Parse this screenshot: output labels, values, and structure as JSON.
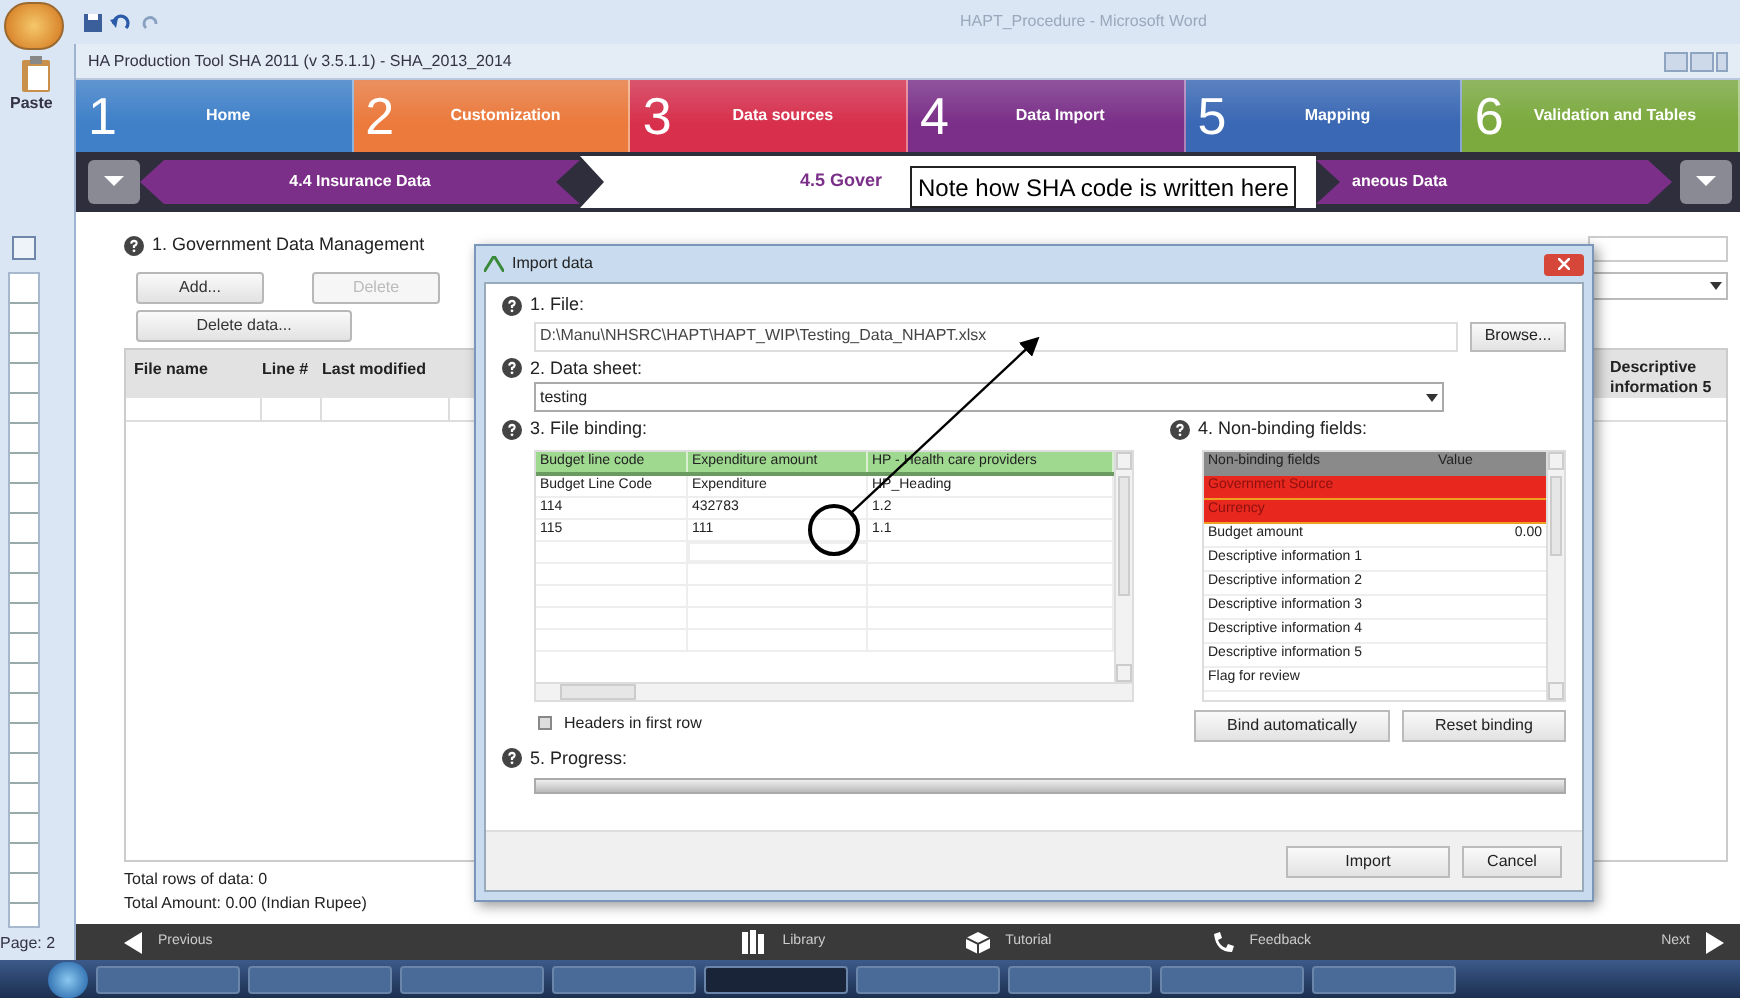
{
  "word_title": "HAPT_Procedure - Microsoft Word",
  "ribbon": {
    "paste": "Paste"
  },
  "app_title": "HA Production Tool SHA 2011 (v 3.5.1.1) - SHA_2013_2014",
  "steps": [
    {
      "number": "1",
      "label": "Home",
      "color": "#3f80c8"
    },
    {
      "number": "2",
      "label": "Customization",
      "color": "#ec7a3c"
    },
    {
      "number": "3",
      "label": "Data sources",
      "color": "#d8304c"
    },
    {
      "number": "4",
      "label": "Data Import",
      "color": "#7b2f88"
    },
    {
      "number": "5",
      "label": "Mapping",
      "color": "#3a68b4"
    },
    {
      "number": "6",
      "label": "Validation and Tables",
      "color": "#7caa3e"
    }
  ],
  "subnav": {
    "previous": "4.4 Insurance Data",
    "current": "4.5 Gover",
    "next": "aneous Data"
  },
  "annotation": {
    "text": "Note how SHA code is written here"
  },
  "panel": {
    "title": "1. Government Data Management",
    "buttons": [
      {
        "label": "Add...",
        "disabled": false
      },
      {
        "label": "Delete",
        "disabled": true
      },
      {
        "label": "Delete data...",
        "disabled": false
      }
    ],
    "columns": [
      "File name",
      "Line #",
      "Last modified",
      "Descriptive information 5"
    ],
    "total_rows": "Total rows of data: 0",
    "total_amount": "Total Amount: 0.00 (Indian Rupee)"
  },
  "dialog": {
    "title": "Import data",
    "file_label": "1. File:",
    "file_path": "D:\\Manu\\NHSRC\\HAPT\\HAPT_WIP\\Testing_Data_NHAPT.xlsx",
    "browse": "Browse...",
    "sheet_label": "2. Data sheet:",
    "sheet": "testing",
    "binding_label": "3. File binding:",
    "binding_columns": [
      "Budget line code",
      "Expenditure amount",
      "HP - Health care providers"
    ],
    "binding_rows": [
      [
        "Budget Line Code",
        "Expenditure",
        "HP_Heading"
      ],
      [
        "114",
        "432783",
        "1.2"
      ],
      [
        "115",
        "111",
        "1.1"
      ]
    ],
    "headers_in_first_row": {
      "label": "Headers in first row",
      "checked": false
    },
    "nonbinding_label": "4. Non-binding fields:",
    "nonbinding_columns": [
      "Non-binding fields",
      "Value"
    ],
    "nonbinding_rows": [
      {
        "field": "Government Source",
        "missing": true
      },
      {
        "field": "Currency",
        "missing": true
      },
      {
        "field": "Budget amount",
        "value": "0.00",
        "missing": false
      },
      {
        "field": "Descriptive information 1",
        "missing": false
      },
      {
        "field": "Descriptive information 2",
        "missing": false
      },
      {
        "field": "Descriptive information 3",
        "missing": false
      },
      {
        "field": "Descriptive information 4",
        "missing": false
      },
      {
        "field": "Descriptive information 5",
        "missing": false
      },
      {
        "field": "Flag for review",
        "missing": false
      }
    ],
    "bind_buttons": [
      "Bind automatically",
      "Reset binding"
    ],
    "progress_label": "5. Progress:",
    "progress": {
      "level": 0
    },
    "import": "Import",
    "cancel": "Cancel"
  },
  "footer": [
    {
      "label": "Previous",
      "kind": "previous"
    },
    {
      "label": "Library",
      "kind": "library"
    },
    {
      "label": "Tutorial",
      "kind": "tutorial"
    },
    {
      "label": "Feedback",
      "kind": "feedback"
    },
    {
      "label": "Next",
      "kind": "next"
    }
  ],
  "status": {
    "page": "Page: 2"
  }
}
